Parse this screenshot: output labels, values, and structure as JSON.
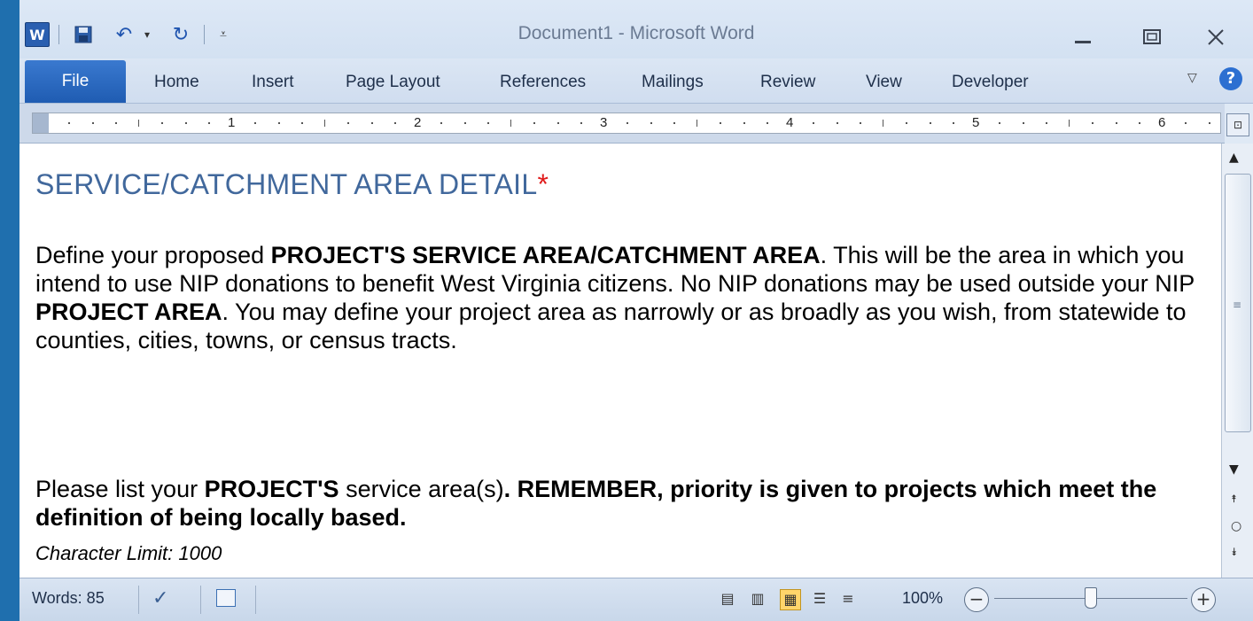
{
  "window": {
    "title": "Document1  -  Microsoft Word",
    "app_icon": "W"
  },
  "ribbon": {
    "tabs": {
      "file": "File",
      "home": "Home",
      "insert": "Insert",
      "page_layout": "Page Layout",
      "references": "References",
      "mailings": "Mailings",
      "review": "Review",
      "view": "View",
      "developer": "Developer"
    },
    "help": "?"
  },
  "ruler": {
    "numbers": [
      "1",
      "2",
      "3",
      "4",
      "5",
      "6"
    ]
  },
  "document": {
    "heading": "SERVICE/CATCHMENT AREA DETAIL",
    "heading_marker": "*",
    "para1": [
      {
        "text": "Define your proposed ",
        "bold": false
      },
      {
        "text": "PROJECT'S SERVICE AREA/CATCHMENT AREA",
        "bold": true
      },
      {
        "text": ". This will be the area in which you intend to use NIP donations to benefit West Virginia citizens. No NIP donations may be used outside your NIP ",
        "bold": false
      },
      {
        "text": "PROJECT AREA",
        "bold": true
      },
      {
        "text": ". You may define your project area as narrowly or as broadly as you wish, from statewide to counties, cities, towns, or census tracts.",
        "bold": false
      }
    ],
    "para2": [
      {
        "text": "Please list your ",
        "bold": false
      },
      {
        "text": "PROJECT'S",
        "bold": true
      },
      {
        "text": " service area(s)",
        "bold": false
      },
      {
        "text": ". REMEMBER, priority is given to projects which meet the definition of being locally based.",
        "bold": true
      }
    ],
    "char_limit": "Character Limit: 1000"
  },
  "status_bar": {
    "words": "Words: 85",
    "zoom": "100%",
    "zoom_minus": "−",
    "zoom_plus": "+",
    "zoom_fraction": 0.5
  },
  "colors": {
    "heading": "#41689c",
    "marker": "#e01b1b",
    "file_tab": "#2a6ac4"
  }
}
